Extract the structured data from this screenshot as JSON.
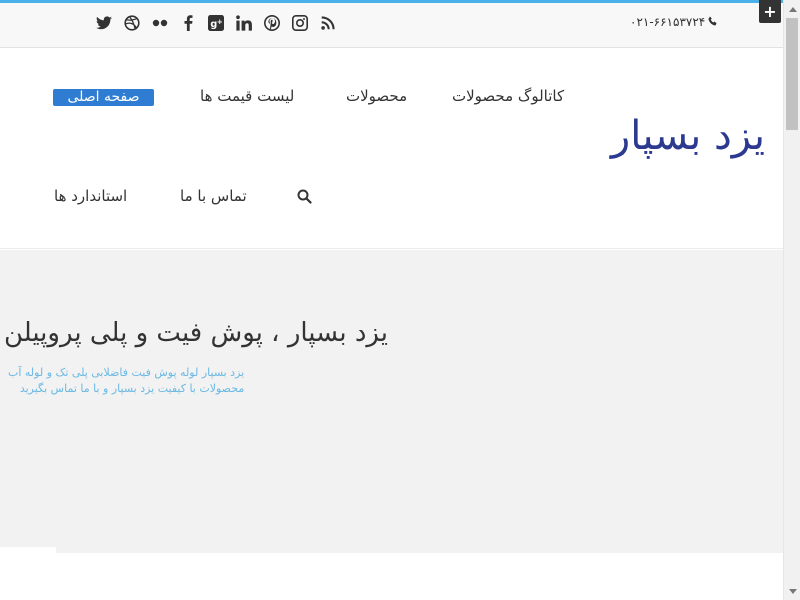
{
  "topbar": {
    "phone": "۰۲۱-۶۶۱۵۳۷۲۴",
    "social_icons": [
      "twitter-icon",
      "dribbble-icon",
      "flickr-icon",
      "facebook-icon",
      "google-plus-icon",
      "linkedin-icon",
      "pinterest-icon",
      "instagram-icon",
      "rss-icon"
    ],
    "corner_button": "+"
  },
  "header": {
    "logo": "یزد بسپار",
    "nav": {
      "home": "صفحه اصلی",
      "price_list": "لیست قیمت ها",
      "products": "محصولات",
      "catalog": "کاتالوگ محصولات",
      "standards": "استاندارد ها",
      "contact": "تماس با ما"
    }
  },
  "hero": {
    "title": "یزد بسپار ، پوش فیت و پلی پروپیلن",
    "sub_line1": "یزد بسپار لوله پوش فیت فاضلابی پلی تک و لوله آب",
    "sub_line2": "محصولات با کیفیت یزد بسپار و با ما تماس بگیرید"
  },
  "colors": {
    "accent": "#4ab0e8",
    "logo": "#2b3990",
    "nav_active": "#2f7dd2",
    "hero_text": "#6ab8e4"
  }
}
